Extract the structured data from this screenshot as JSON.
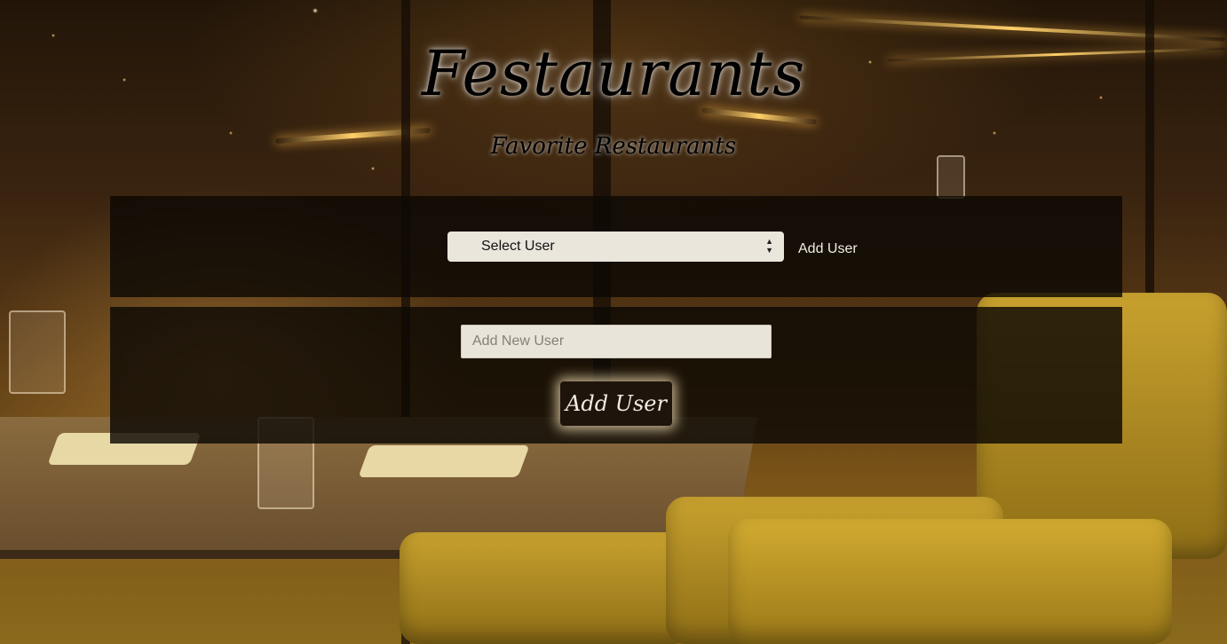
{
  "header": {
    "title": "Festaurants",
    "subtitle": "Favorite Restaurants"
  },
  "user_select": {
    "selected": "Select User",
    "add_link": "Add User"
  },
  "new_user_form": {
    "input_value": "",
    "input_placeholder": "Add New User",
    "submit_label": "Add User"
  },
  "colors": {
    "panel_bg": "#0c0804",
    "input_bg": "#ebe6dc",
    "button_bg": "#1e140b",
    "button_text": "#f2ede4",
    "title_text": "#000000"
  },
  "icons": {
    "select_arrows": "sort-arrows-icon"
  }
}
